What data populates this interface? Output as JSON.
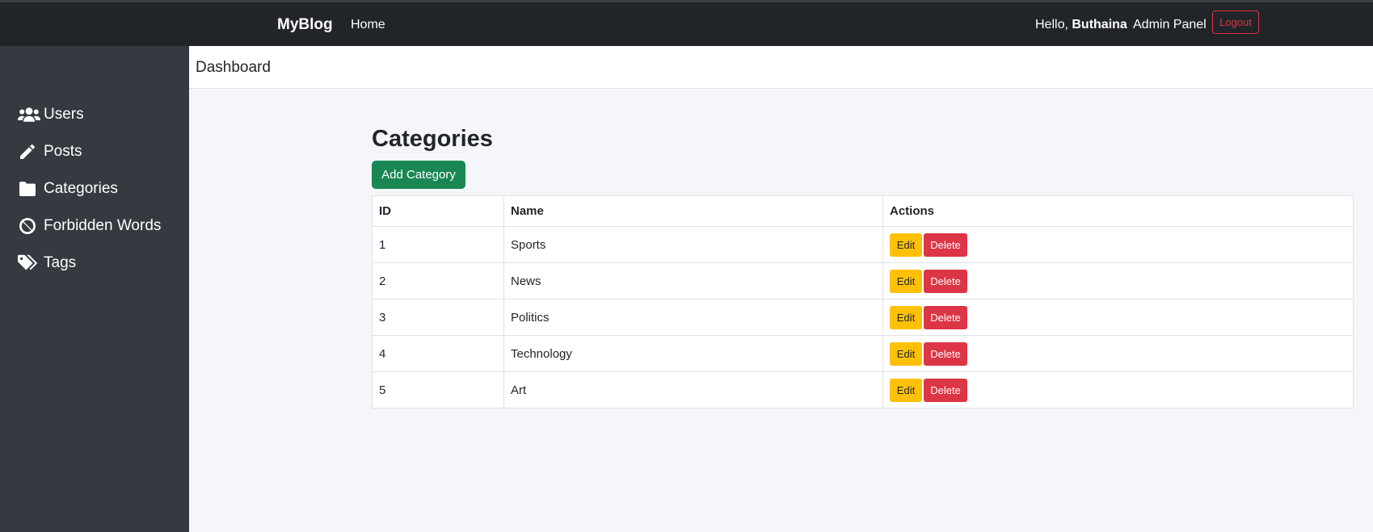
{
  "navbar": {
    "brand": "MyBlog",
    "home": "Home",
    "hello_prefix": "Hello,",
    "username": "Buthaina",
    "admin_panel": "Admin Panel",
    "logout": "Logout"
  },
  "sidebar": {
    "items": [
      {
        "label": "Users",
        "icon": "users-icon"
      },
      {
        "label": "Posts",
        "icon": "pencil-icon"
      },
      {
        "label": "Categories",
        "icon": "folder-icon"
      },
      {
        "label": "Forbidden Words",
        "icon": "ban-icon"
      },
      {
        "label": "Tags",
        "icon": "tags-icon"
      }
    ]
  },
  "header": {
    "breadcrumb": "Dashboard"
  },
  "main": {
    "title": "Categories",
    "add_button": "Add Category",
    "table": {
      "headers": [
        "ID",
        "Name",
        "Actions"
      ],
      "rows": [
        {
          "id": "1",
          "name": "Sports"
        },
        {
          "id": "2",
          "name": "News"
        },
        {
          "id": "3",
          "name": "Politics"
        },
        {
          "id": "4",
          "name": "Technology"
        },
        {
          "id": "5",
          "name": "Art"
        }
      ],
      "edit_label": "Edit",
      "delete_label": "Delete"
    }
  },
  "colors": {
    "navbar_bg": "#212529",
    "sidebar_bg": "#343a40",
    "success": "#198754",
    "warning": "#ffc107",
    "danger": "#dc3545"
  }
}
